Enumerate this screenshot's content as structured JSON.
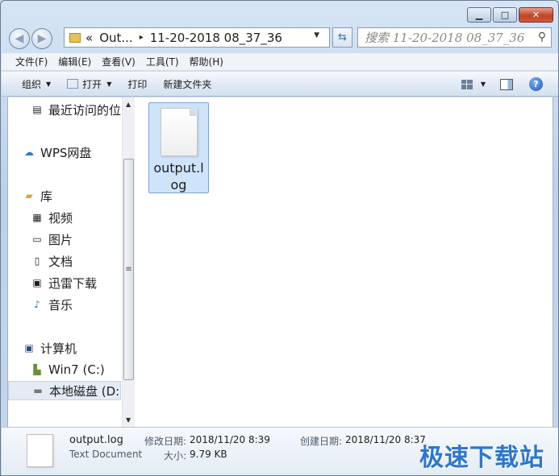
{
  "window": {
    "caption": {
      "minimize": "▁",
      "maximize": "□",
      "close": "✕"
    }
  },
  "address": {
    "chevron": "«",
    "parent": "Out...",
    "separator": "▸",
    "current": "11-20-2018 08_37_36",
    "dropdown": "▼"
  },
  "search": {
    "placeholder": "搜索 11-20-2018 08_37_36"
  },
  "menu": {
    "items": [
      "文件(F)",
      "编辑(E)",
      "查看(V)",
      "工具(T)",
      "帮助(H)"
    ]
  },
  "commands": {
    "organize": "组织",
    "open": "打开",
    "print": "打印",
    "new_folder": "新建文件夹"
  },
  "nav": {
    "items": [
      {
        "label": "最近访问的位",
        "icon": "recent-places-icon"
      },
      {
        "label": "WPS网盘",
        "icon": "cloud-icon"
      },
      {
        "label": "库",
        "icon": "library-icon"
      },
      {
        "label": "视频",
        "icon": "video-icon"
      },
      {
        "label": "图片",
        "icon": "picture-icon"
      },
      {
        "label": "文档",
        "icon": "document-icon"
      },
      {
        "label": "迅雷下载",
        "icon": "download-icon"
      },
      {
        "label": "音乐",
        "icon": "music-icon"
      },
      {
        "label": "计算机",
        "icon": "computer-icon"
      },
      {
        "label": "Win7 (C:)",
        "icon": "drive-c-icon"
      },
      {
        "label": "本地磁盘 (D:",
        "icon": "drive-d-icon"
      }
    ]
  },
  "files": [
    {
      "name": "output.log"
    }
  ],
  "details": {
    "name": "output.log",
    "type": "Text Document",
    "modified_label": "修改日期:",
    "modified_value": "2018/11/20 8:39",
    "created_label": "创建日期:",
    "created_value": "2018/11/20 8:37",
    "size_label": "大小:",
    "size_value": "9.79 KB"
  },
  "watermark": "极速下载站"
}
